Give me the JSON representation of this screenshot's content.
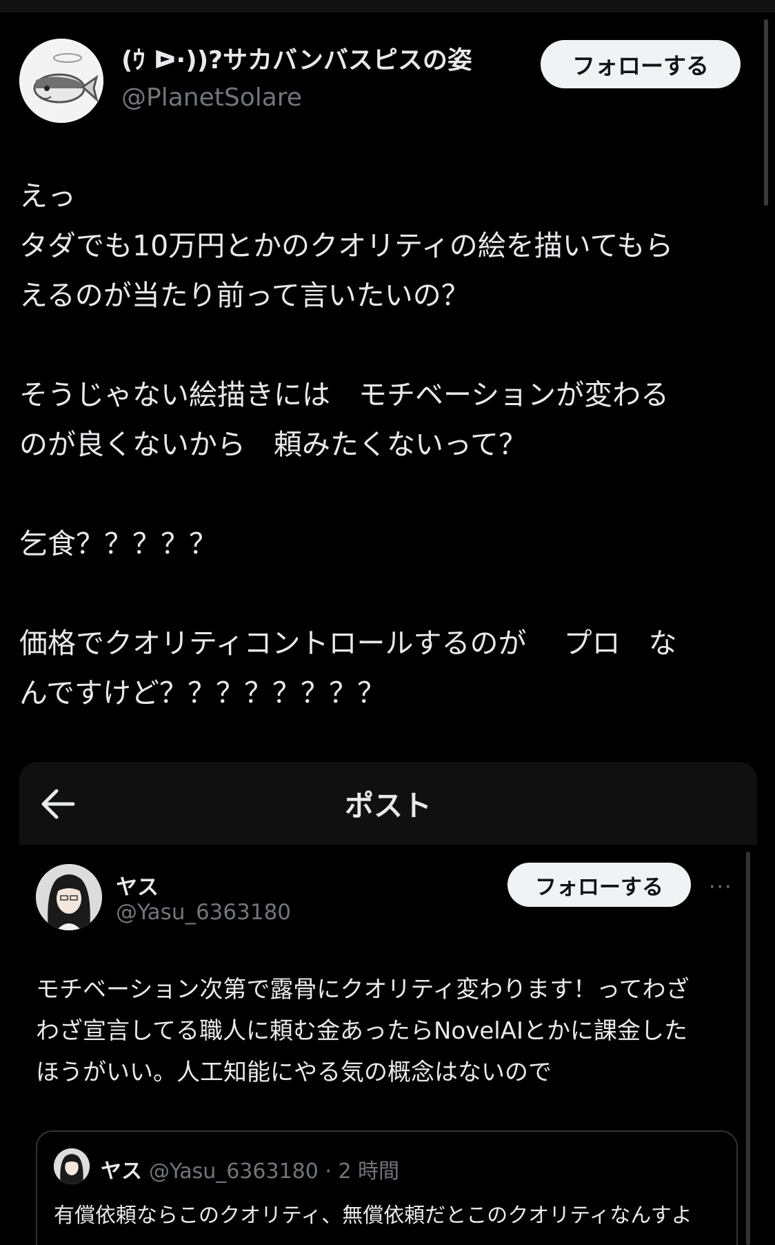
{
  "profile": {
    "display_name": "(ｳ ᐅ·))?サカバンバスピスの姿",
    "handle": "@PlanetSolare",
    "follow_label": "フォローする"
  },
  "tweet": {
    "lines": [
      "えっ",
      "タダでも10万円とかのクオリティの絵を描いてもら",
      "えるのが当たり前って言いたいの？",
      "",
      "そうじゃない絵描きには　モチベーションが変わる",
      "のが良くないから　頼みたくないって？",
      "",
      "乞食？？？？？",
      "",
      "価格でクオリティコントロールするのが　 プロ　な",
      "んですけど？？？？？？？？"
    ]
  },
  "embed": {
    "header_title": "ポスト",
    "author": {
      "name": "ヤス",
      "handle": "@Yasu_6363180",
      "follow_label": "フォローする",
      "more": "···"
    },
    "text_lines": [
      "モチベーション次第で露骨にクオリティ変わります！ってわざ",
      "わざ宣言してる職人に頼む金あったらNovelAIとかに課金した",
      "ほうがいい。人工知能にやる気の概念はないので"
    ],
    "quote": {
      "name": "ヤス",
      "handle_time": "@Yasu_6363180 · 2 時間",
      "text": "有償依頼ならこのクオリティ、無償依頼だとこのクオリティなんすよ"
    }
  }
}
